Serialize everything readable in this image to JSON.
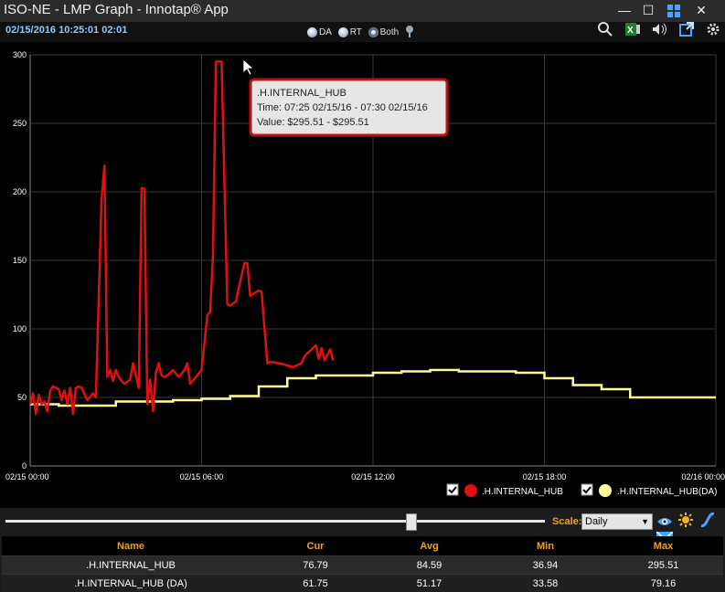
{
  "window": {
    "title": "ISO-NE - LMP Graph - Innotap® App",
    "minimize": "—",
    "maximize": "☐",
    "close": "✕"
  },
  "toolbar": {
    "timestamp": "02/15/2016 10:25:01  02:01",
    "radio": [
      {
        "label": "DA",
        "selected": false
      },
      {
        "label": "RT",
        "selected": false
      },
      {
        "label": "Both",
        "selected": true
      }
    ],
    "icons": [
      "search-icon",
      "excel-icon",
      "speaker-icon",
      "popout-icon",
      "gear-icon"
    ]
  },
  "chart_data": {
    "type": "line",
    "ylim": [
      0,
      300
    ],
    "yticks": [
      "0",
      "50",
      "100",
      "150",
      "200",
      "250",
      "300"
    ],
    "xlim_hours": [
      0,
      24
    ],
    "xticks": [
      "02/15 00:00",
      "02/15 06:00",
      "02/15 12:00",
      "02/15 18:00",
      "02/16 00:00"
    ],
    "grid": true,
    "legend_position": "bottom-right",
    "series": [
      {
        "name": ".H.INTERNAL_HUB",
        "color": "#e01010",
        "x": [
          0,
          0.1,
          0.2,
          0.3,
          0.4,
          0.5,
          0.6,
          0.7,
          0.8,
          1.0,
          1.1,
          1.2,
          1.3,
          1.4,
          1.5,
          1.6,
          1.7,
          1.8,
          2.0,
          2.2,
          2.3,
          2.5,
          2.6,
          2.7,
          2.8,
          2.9,
          3.0,
          3.1,
          3.2,
          3.3,
          3.5,
          3.6,
          3.8,
          3.9,
          4.0,
          4.1,
          4.2,
          4.3,
          4.4,
          4.5,
          4.6,
          4.7,
          4.8,
          4.9,
          5.0,
          5.2,
          5.4,
          5.5,
          5.6,
          6.0,
          6.1,
          6.2,
          6.3,
          6.4,
          6.5,
          6.7,
          6.9,
          7.0,
          7.2,
          7.3,
          7.5,
          7.6,
          7.7,
          8.0,
          8.1,
          8.3,
          8.4,
          8.7,
          8.9,
          9.2,
          9.5,
          9.6,
          10.0,
          10.1,
          10.2,
          10.3,
          10.5,
          10.6
        ],
        "y": [
          45,
          53,
          38,
          52,
          45,
          47,
          40,
          55,
          58,
          56,
          48,
          55,
          45,
          57,
          38,
          57,
          58,
          57,
          48,
          53,
          50,
          195,
          219,
          65,
          70,
          62,
          70,
          65,
          62,
          60,
          63,
          75,
          57,
          203,
          202,
          45,
          63,
          40,
          68,
          75,
          66,
          65,
          66,
          68,
          70,
          65,
          70,
          75,
          60,
          70,
          90,
          110,
          112,
          155,
          295,
          295,
          118,
          117,
          120,
          130,
          148,
          148,
          124,
          128,
          127,
          75,
          76,
          75,
          74,
          72,
          75,
          80,
          88,
          78,
          86,
          77,
          85,
          77
        ]
      },
      {
        "name": ".H.INTERNAL_HUB(DA)",
        "color": "#ffff99",
        "hourly": [
          45,
          44,
          44,
          47,
          47,
          48,
          49,
          51,
          58,
          64,
          66,
          66,
          68,
          69,
          70,
          69,
          69,
          68,
          64,
          59,
          56,
          50,
          50,
          50
        ]
      }
    ],
    "tooltip": {
      "line1": ".H.INTERNAL_HUB",
      "line2": "Time: 07:25 02/15/16 - 07:30 02/15/16",
      "line3": "Value: $295.51 - $295.51"
    }
  },
  "legend": [
    {
      "label": ".H.INTERNAL_HUB",
      "checked": true,
      "color": "#e01010"
    },
    {
      "label": ".H.INTERNAL_HUB(DA)",
      "checked": true,
      "color": "#ffff99"
    }
  ],
  "bottom": {
    "scale_label": "Scale:",
    "scale_value": "Daily",
    "slider_value": 0.75,
    "icons": [
      "eye-icon",
      "sun-icon",
      "curve-icon",
      "mail-icon"
    ]
  },
  "table": {
    "headers": [
      "Name",
      "Cur",
      "Avg",
      "Min",
      "Max"
    ],
    "rows": [
      [
        ".H.INTERNAL_HUB",
        "76.79",
        "84.59",
        "36.94",
        "295.51"
      ],
      [
        ".H.INTERNAL_HUB (DA)",
        "61.75",
        "51.17",
        "33.58",
        "79.16"
      ]
    ]
  }
}
